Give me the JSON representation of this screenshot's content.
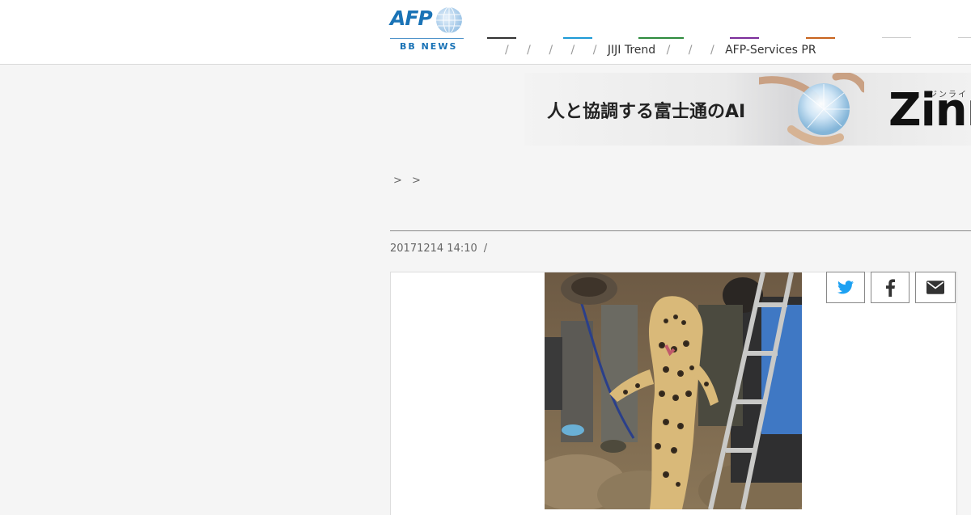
{
  "header": {
    "logo": {
      "brand": "AFP",
      "sub": "BB NEWS"
    },
    "nav": {
      "separator": "/",
      "items": [
        "",
        "",
        "",
        "",
        "",
        "JIJI Trend",
        "",
        "",
        "AFP-Services PR"
      ],
      "bar_colors": [
        "#333333",
        "#1e9ad6",
        "#2e8b3d",
        "#7b2d9a",
        "#c8641e",
        "#cccccc",
        "#cccccc"
      ]
    }
  },
  "ad": {
    "headline": "人と協調する富士通のAI",
    "brand": "Zinr",
    "ruby": "ジンライ"
  },
  "article": {
    "breadcrumb": "> >",
    "title": "",
    "date": "20171214 14:10",
    "meta_separator": "/"
  },
  "share": {
    "icons": [
      "twitter-icon",
      "facebook-icon",
      "email-icon"
    ],
    "twitter_color": "#1da1f2",
    "icon_color": "#333333"
  }
}
